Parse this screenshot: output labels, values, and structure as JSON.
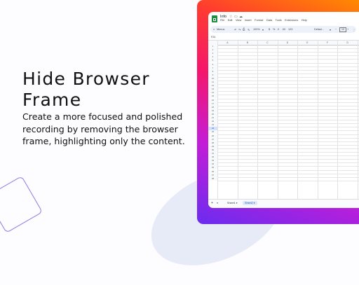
{
  "headline": "Hide Browser Frame",
  "description": "Create a more focused and polished recording by removing the browser frame, highlighting only the content.",
  "sheet": {
    "doc_title": "Info",
    "menu": [
      "File",
      "Edit",
      "View",
      "Insert",
      "Format",
      "Data",
      "Tools",
      "Extensions",
      "Help"
    ],
    "toolbar": {
      "search_menus": "Menus",
      "zoom": "100%",
      "font": "Defaul...",
      "font_size": "10"
    },
    "cell_ref": "F24",
    "columns": [
      "A",
      "B",
      "C",
      "D",
      "E",
      "F",
      "G"
    ],
    "rows": [
      "1",
      "2",
      "3",
      "4",
      "5",
      "6",
      "7",
      "8",
      "9",
      "10",
      "11",
      "12",
      "13",
      "14",
      "15",
      "16",
      "17",
      "18",
      "19",
      "20",
      "21",
      "22",
      "23",
      "24",
      "25",
      "26",
      "27",
      "28",
      "29",
      "30",
      "31",
      "32",
      "33",
      "34",
      "35",
      "36",
      "37",
      "38"
    ],
    "selected_row": "24",
    "sheet_tabs": [
      "Sheet1",
      "Sheet2"
    ],
    "active_sheet": "Sheet2"
  },
  "colors": {
    "sheets_green": "#1e8e3e",
    "selection_blue": "#0b57d0"
  }
}
